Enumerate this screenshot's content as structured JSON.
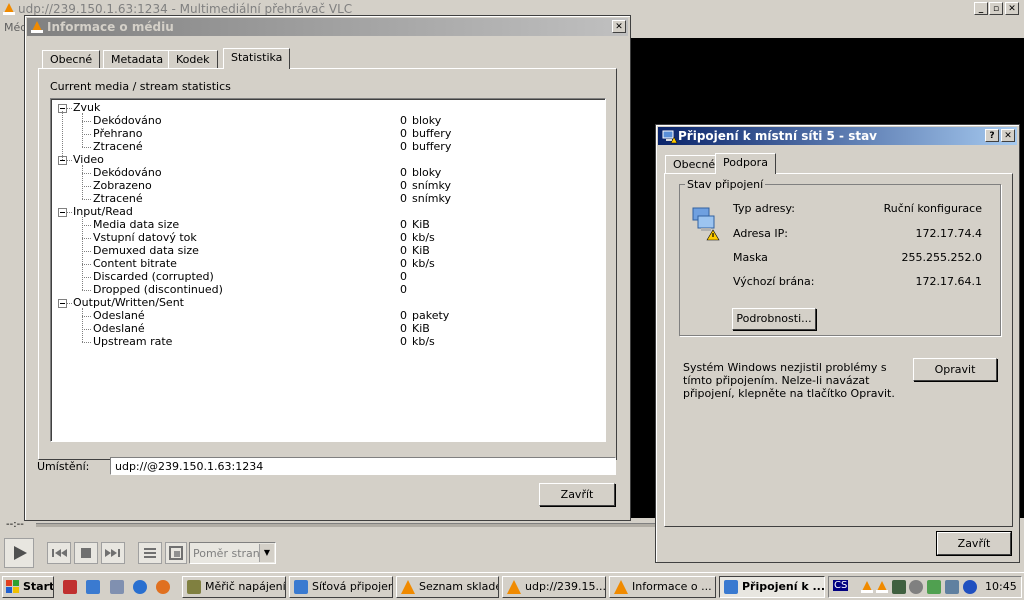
{
  "vlc": {
    "title": "udp://239.150.1.63:1234 - Multimediální přehrávač VLC",
    "menu_first": "Méd",
    "time": "--:--",
    "aspect_placeholder": "Poměr stran"
  },
  "media_info": {
    "title": "Informace o médiu",
    "tabs": [
      "Obecné",
      "Metadata",
      "Kodek",
      "Statistika"
    ],
    "section_label": "Current media / stream statistics",
    "groups": [
      {
        "name": "Zvuk",
        "rows": [
          {
            "label": "Dekódováno",
            "value": "0",
            "unit": "bloky"
          },
          {
            "label": "Přehrano",
            "value": "0",
            "unit": "buffery"
          },
          {
            "label": "Ztracené",
            "value": "0",
            "unit": "buffery"
          }
        ]
      },
      {
        "name": "Video",
        "rows": [
          {
            "label": "Dekódováno",
            "value": "0",
            "unit": "bloky"
          },
          {
            "label": "Zobrazeno",
            "value": "0",
            "unit": "snímky"
          },
          {
            "label": "Ztracené",
            "value": "0",
            "unit": "snímky"
          }
        ]
      },
      {
        "name": "Input/Read",
        "rows": [
          {
            "label": "Media data size",
            "value": "0",
            "unit": "KiB"
          },
          {
            "label": "Vstupní datový tok",
            "value": "0",
            "unit": "kb/s"
          },
          {
            "label": "Demuxed data size",
            "value": "0",
            "unit": "KiB"
          },
          {
            "label": "Content bitrate",
            "value": "0",
            "unit": "kb/s"
          },
          {
            "label": "Discarded (corrupted)",
            "value": "0",
            "unit": ""
          },
          {
            "label": "Dropped (discontinued)",
            "value": "0",
            "unit": ""
          }
        ]
      },
      {
        "name": "Output/Written/Sent",
        "rows": [
          {
            "label": "Odeslané",
            "value": "0",
            "unit": "pakety"
          },
          {
            "label": "Odeslané",
            "value": "0",
            "unit": "KiB"
          },
          {
            "label": "Upstream rate",
            "value": "0",
            "unit": "kb/s"
          }
        ]
      }
    ],
    "location_label": "Umístění:",
    "location_value": "udp://@239.150.1.63:1234",
    "close_label": "Zavřít"
  },
  "network": {
    "title": "Připojení k místní síti 5 - stav",
    "help": "?",
    "tabs": [
      "Obecné",
      "Podpora"
    ],
    "group_label": "Stav připojení",
    "rows": [
      {
        "label": "Typ adresy:",
        "value": "Ruční konfigurace"
      },
      {
        "label": "Adresa IP:",
        "value": "172.17.74.4"
      },
      {
        "label": "Maska",
        "value": "255.255.252.0"
      },
      {
        "label": "Výchozí brána:",
        "value": "172.17.64.1"
      }
    ],
    "details_label": "Podrobnosti...",
    "message": "Systém Windows nezjistil problémy s tímto připojením. Nelze-li navázat připojení, klepněte na tlačítko Opravit.",
    "repair_label": "Opravit",
    "close_label": "Zavřít"
  },
  "taskbar": {
    "start_label": "Start",
    "tasks": [
      {
        "label": "Měřič napájení",
        "icon": "battery-icon"
      },
      {
        "label": "Síťová připojení",
        "icon": "network-icon"
      },
      {
        "label": "Seznam skladeb",
        "icon": "vlc-icon"
      },
      {
        "label": "udp://239.15...",
        "icon": "vlc-icon"
      },
      {
        "label": "Informace o ...",
        "icon": "vlc-icon"
      },
      {
        "label": "Připojení k ...",
        "icon": "network-icon"
      }
    ],
    "tray_cs": "CS",
    "clock": "10:45"
  }
}
